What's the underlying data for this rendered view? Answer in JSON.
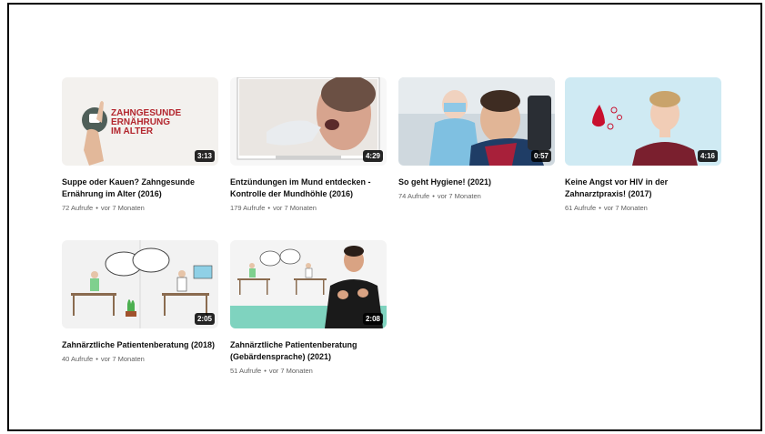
{
  "videos": [
    {
      "title": "Suppe oder Kauen? Zahngesunde Ernährung im Alter (2016)",
      "duration": "3:13",
      "views": "72 Aufrufe",
      "age": "vor 7 Monaten",
      "thumb_text": [
        "ZAHNGESUNDE",
        "ERNÄHRUNG",
        "IM ALTER"
      ]
    },
    {
      "title": "Entzündungen im Mund entdecken - Kontrolle der Mundhöhle (2016)",
      "duration": "4:29",
      "views": "179 Aufrufe",
      "age": "vor 7 Monaten"
    },
    {
      "title": "So geht Hygiene! (2021)",
      "duration": "0:57",
      "views": "74 Aufrufe",
      "age": "vor 7 Monaten"
    },
    {
      "title": "Keine Angst vor HIV in der Zahnarztpraxis! (2017)",
      "duration": "4:16",
      "views": "61 Aufrufe",
      "age": "vor 7 Monaten"
    },
    {
      "title": "Zahnärztliche Patientenberatung (2018)",
      "duration": "2:05",
      "views": "40 Aufrufe",
      "age": "vor 7 Monaten"
    },
    {
      "title": "Zahnärztliche Patientenberatung (Gebärdensprache) (2021)",
      "duration": "2:08",
      "views": "51 Aufrufe",
      "age": "vor 7 Monaten"
    }
  ],
  "separator": "•",
  "colors": {
    "thumb1_text": "#b3262e",
    "thumb4_bg": "#cfeaf3",
    "thumb4_drop": "#c8102e",
    "thumb6_accent": "#7fd3bf"
  }
}
